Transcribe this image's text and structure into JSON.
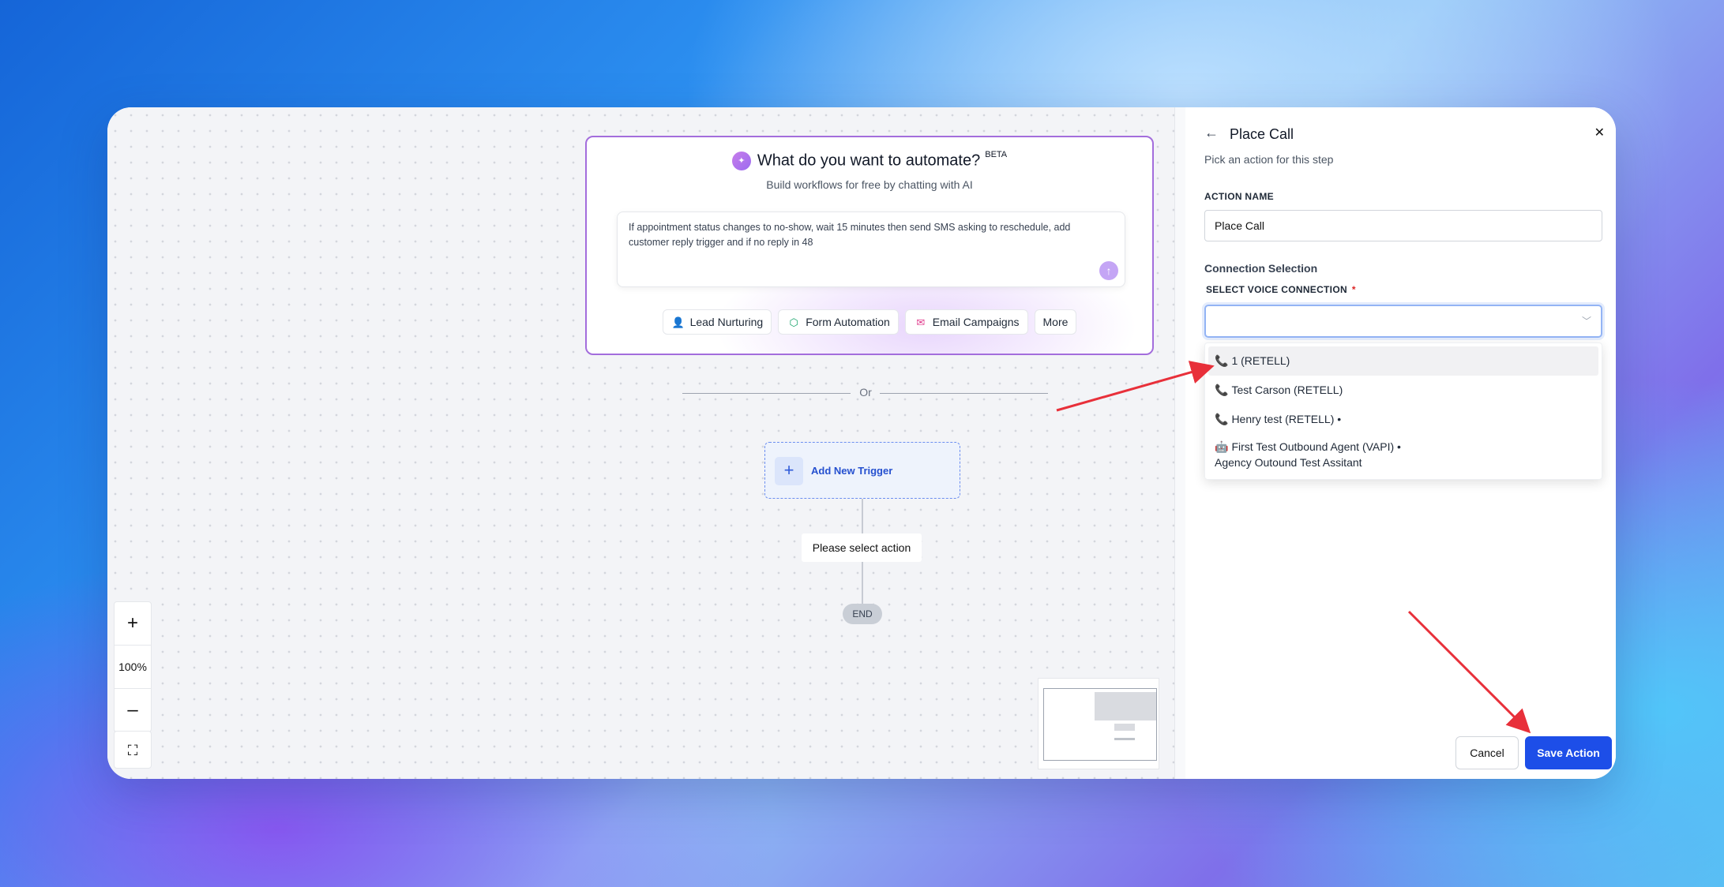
{
  "canvas": {
    "ai_card": {
      "title": "What do you want to automate?",
      "badge": "BETA",
      "subtitle": "Build workflows for free by chatting with AI",
      "prompt_text": "If appointment status changes to no-show, wait 15 minutes then send SMS asking to reschedule, add customer reply trigger and if no reply in 48",
      "chips": [
        {
          "label": "Lead Nurturing",
          "icon": "user-icon"
        },
        {
          "label": "Form Automation",
          "icon": "cube-icon"
        },
        {
          "label": "Email Campaigns",
          "icon": "mail-icon"
        },
        {
          "label": "More",
          "icon": ""
        }
      ]
    },
    "separator_text": "Or",
    "trigger_label": "Add New Trigger",
    "select_action_label": "Please select action",
    "end_label": "END",
    "zoom": {
      "plus": "+",
      "level": "100%",
      "minus": "–"
    }
  },
  "panel": {
    "title": "Place Call",
    "subtitle": "Pick an action for this step",
    "action_name_label": "ACTION NAME",
    "action_name_value": "Place Call",
    "connection_section": "Connection Selection",
    "voice_label": "SELECT VOICE CONNECTION",
    "required_mark": "*",
    "options": [
      {
        "icon": "📞",
        "label": "1 (RETELL)"
      },
      {
        "icon": "📞",
        "label": "Test Carson (RETELL)"
      },
      {
        "icon": "📞",
        "label": "Henry test (RETELL) •"
      },
      {
        "icon": "🤖",
        "label": "First Test Outbound Agent (VAPI) •",
        "sub": "Agency Outound Test Assitant"
      }
    ],
    "cancel_label": "Cancel",
    "save_label": "Save Action"
  },
  "colors": {
    "accent": "#1d4ee8",
    "ai_border": "#a36ddc",
    "arrow": "#e8303a"
  }
}
